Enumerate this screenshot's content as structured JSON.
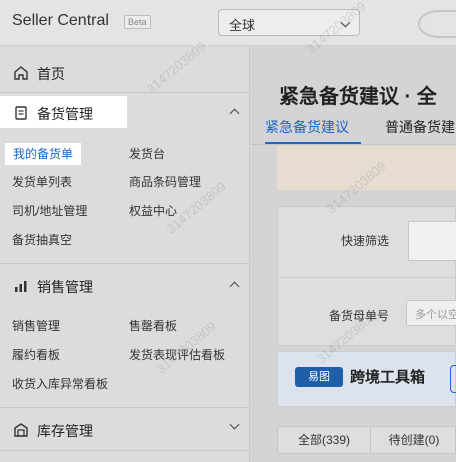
{
  "header": {
    "app_title": "Seller Central",
    "beta_badge": "Beta",
    "region_select": {
      "value": "全球"
    }
  },
  "sidebar": {
    "home": {
      "label": "首页",
      "icon": "home-icon"
    },
    "stock_mgmt": {
      "label": "备货管理",
      "icon": "clipboard-icon",
      "items": [
        {
          "label": "我的备货单",
          "active": true
        },
        {
          "label": "发货台"
        },
        {
          "label": "发货单列表"
        },
        {
          "label": "商品条码管理"
        },
        {
          "label": "司机/地址管理"
        },
        {
          "label": "权益中心"
        },
        {
          "label": "备货抽真空"
        }
      ]
    },
    "sales_mgmt": {
      "label": "销售管理",
      "icon": "bar-chart-icon",
      "items": [
        {
          "label": "销售管理"
        },
        {
          "label": "售罄看板"
        },
        {
          "label": "履约看板"
        },
        {
          "label": "发货表现评估看板"
        },
        {
          "label": "收货入库异常看板"
        }
      ]
    },
    "inventory_mgmt": {
      "label": "库存管理",
      "icon": "warehouse-icon"
    }
  },
  "main": {
    "page_title": "紧急备货建议 · 全",
    "tabs": [
      {
        "label": "紧急备货建议",
        "active": true
      },
      {
        "label": "普通备货建"
      }
    ],
    "filter": {
      "quick_filter_label": "快速筛选",
      "order_no_label": "备货母单号",
      "order_no_placeholder": "多个以空"
    },
    "banner": {
      "logo_text": "易图",
      "text": "跨境工具箱"
    },
    "status_tabs": [
      {
        "label": "全部(339)"
      },
      {
        "label": "待创建(0)"
      }
    ]
  },
  "watermark": "3147203809"
}
